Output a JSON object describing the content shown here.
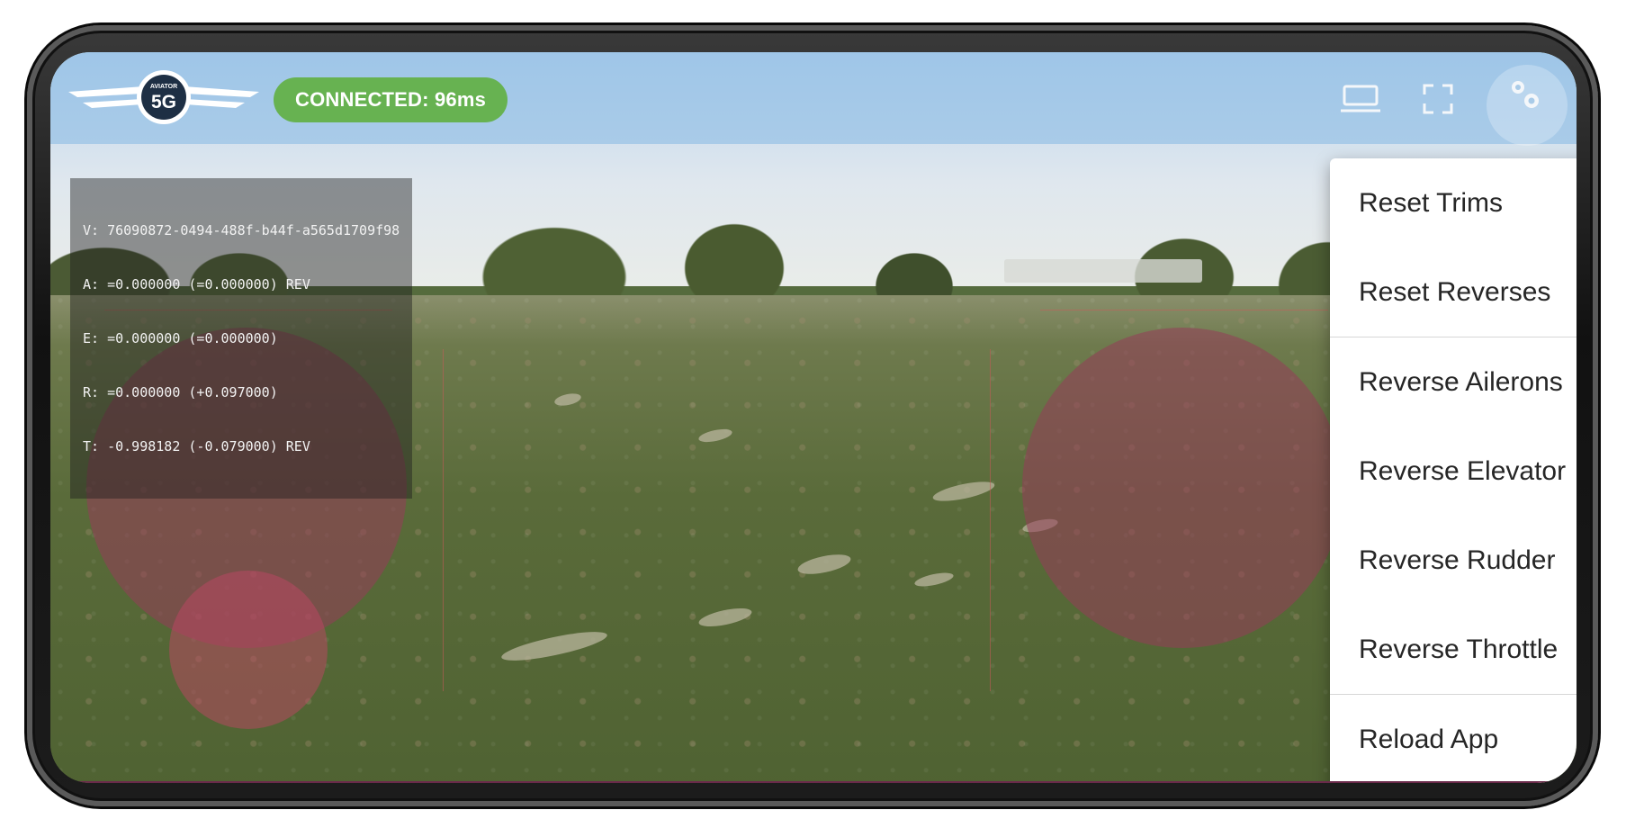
{
  "header": {
    "logo": {
      "brand_top": "AVIATOR",
      "brand_main": "5G"
    },
    "connection_status": "CONNECTED: 96ms",
    "icons": [
      "cast-icon",
      "fullscreen-icon",
      "gear-icon"
    ]
  },
  "telemetry": {
    "lines": [
      "V: 76090872-0494-488f-b44f-a565d1709f98",
      "A: =0.000000 (=0.000000) REV",
      "E: =0.000000 (=0.000000)",
      "R: =0.000000 (+0.097000)",
      "T: -0.998182 (-0.079000) REV"
    ]
  },
  "menu": {
    "items": [
      "Reset Trims",
      "Reset Reverses",
      "Reverse Ailerons",
      "Reverse Elevator",
      "Reverse Rudder",
      "Reverse Throttle",
      "Reload App"
    ]
  },
  "colors": {
    "status_green": "#67b251",
    "stick_overlay": "#963c5a",
    "menu_bg": "#ffffff"
  }
}
